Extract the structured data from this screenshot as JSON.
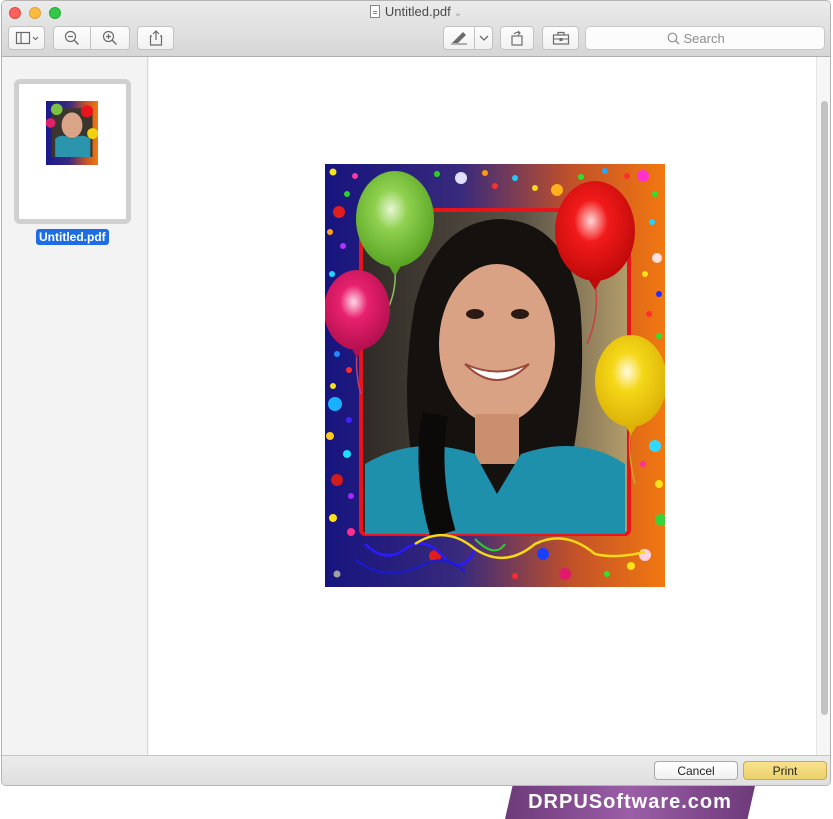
{
  "window": {
    "title": "Untitled.pdf",
    "title_chevron": "⌄"
  },
  "toolbar": {
    "sidebar_toggle_icon": "sidebar-icon",
    "zoom_out_icon": "zoom-out-icon",
    "zoom_in_icon": "zoom-in-icon",
    "share_icon": "share-icon",
    "markup_icon": "pen-icon",
    "rotate_icon": "rotate-icon",
    "toolbox_icon": "toolbox-icon",
    "search_placeholder": "Search"
  },
  "sidebar": {
    "thumbnail_label": "Untitled.pdf"
  },
  "buttons": {
    "cancel": "Cancel",
    "print": "Print"
  },
  "colors": {
    "accent": "#1d6ee5",
    "print_button": "#ecd26b"
  },
  "watermark": {
    "text": "DRPUSoftware.com"
  }
}
